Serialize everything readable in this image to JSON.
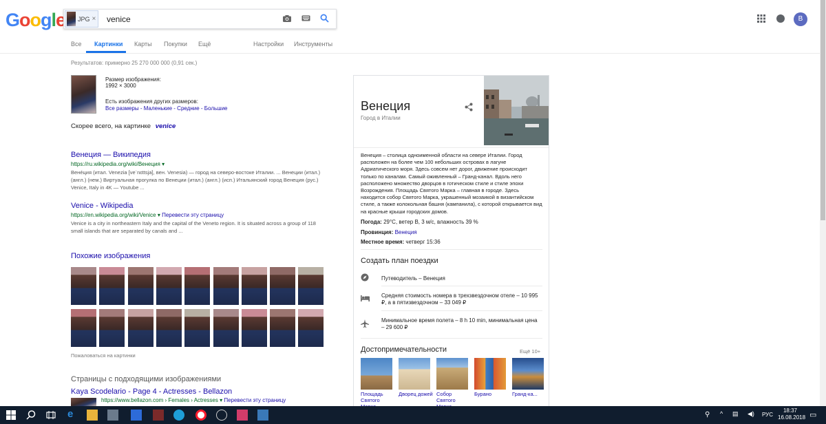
{
  "header": {
    "logo": "Google",
    "search": {
      "chip_label": "JPG",
      "chip_close": "×",
      "query": "venice"
    },
    "avatar_letter": "B"
  },
  "tabs": [
    {
      "label": "Все"
    },
    {
      "label": "Картинки",
      "active": true
    },
    {
      "label": "Карты"
    },
    {
      "label": "Покупки"
    },
    {
      "label": "Ещё"
    },
    {
      "label": "Настройки"
    },
    {
      "label": "Инструменты"
    }
  ],
  "results_stats": "Результатов: примерно 25 270 000 000 (0,91 сек.)",
  "image_info": {
    "size_label": "Размер изображения:",
    "size_value": "1992 × 3000",
    "other_sizes": "Есть изображения других размеров:",
    "sizes_links": "Все размеры - Маленькие - Средние - Большие"
  },
  "best_guess": {
    "prefix": "Скорее всего, на картинке",
    "term": "venice"
  },
  "results": [
    {
      "title": "Венеция — Википедия",
      "url": "https://ru.wikipedia.org/wiki/Венеция",
      "snippet": "Вене́ция (итал. Venezia [veˈnɛttsja], вен. Venesia) — город на северо-востоке Италии. ... Венеции (итал.) (англ.) (нем.) Виртуальная прогулка по Венеции (итал.) (англ.) (исп.) Итальянский город Венеция (рус.) Venice, Italy in 4K — Youtube ..."
    },
    {
      "title": "Venice - Wikipedia",
      "url": "https://en.wikipedia.org/wiki/Venice",
      "translate": "Перевести эту страницу",
      "snippet": "Venice is a city in northeastern Italy and the capital of the Veneto region. It is situated across a group of 118 small islands that are separated by canals and ..."
    }
  ],
  "similar": {
    "title": "Похожие изображения",
    "report": "Пожаловаться на картинки"
  },
  "pages_matching": {
    "title": "Страницы с подходящими изображениями",
    "first_title": "Kaya Scodelario - Page 4 - Actresses - Bellazon",
    "first_url": "https://www.bellazon.com › Females › Actresses",
    "first_translate": "Перевести эту страницу"
  },
  "knowledge_panel": {
    "title": "Венеция",
    "subtitle": "Город в Италии",
    "description": "Венеция – столица одноименной области на севере Италии. Город расположен на более чем 100 небольших островах в лагуне Адриатического моря. Здесь совсем нет дорог, движение происходит только по каналам. Самый оживленный – Гранд-канал. Вдоль него расположено множество дворцов в готическом стиле и стиле эпохи Возрождения. Площадь Святого Марка – главная в городе. Здесь находится собор Святого Марка, украшенный мозаикой в византийском стиле, а также колокольная башня (кампанила), с которой открывается вид на красные крыши городских домов.",
    "facts": [
      {
        "key": "Погода:",
        "value": "29°C, ветер В, 3 м/с, влажность 39 %"
      },
      {
        "key": "Провинция:",
        "value": "Венеция",
        "link": true
      },
      {
        "key": "Местное время:",
        "value": "четверг 15:36"
      }
    ],
    "trip_title": "Создать план поездки",
    "trip_items": [
      {
        "icon": "compass-icon",
        "text": "Путеводитель – Венеция"
      },
      {
        "icon": "bed-icon",
        "text": "Средняя стоимость номера в трехзвездочном отеле – 10 995 ₽, а в пятизвездочном – 33 049 ₽"
      },
      {
        "icon": "plane-icon",
        "text": "Минимальное время полета – 8 h 10 min, минимальная цена – 29 600 ₽"
      }
    ],
    "sights_title": "Достопримечательности",
    "sights_more": "Ещё 10+",
    "sights": [
      {
        "label": "Площадь Святого Марка"
      },
      {
        "label": "Дворец дожей"
      },
      {
        "label": "Собор Святого Марка"
      },
      {
        "label": "Бурано"
      },
      {
        "label": "Гранд-ка..."
      }
    ]
  },
  "taskbar": {
    "lang": "РУС",
    "time": "18:37",
    "date": "16.08.2018"
  },
  "colors": {
    "accent": "#1a73e8",
    "link": "#1a0dab",
    "url_green": "#006621",
    "taskbar": "#101d2e"
  }
}
